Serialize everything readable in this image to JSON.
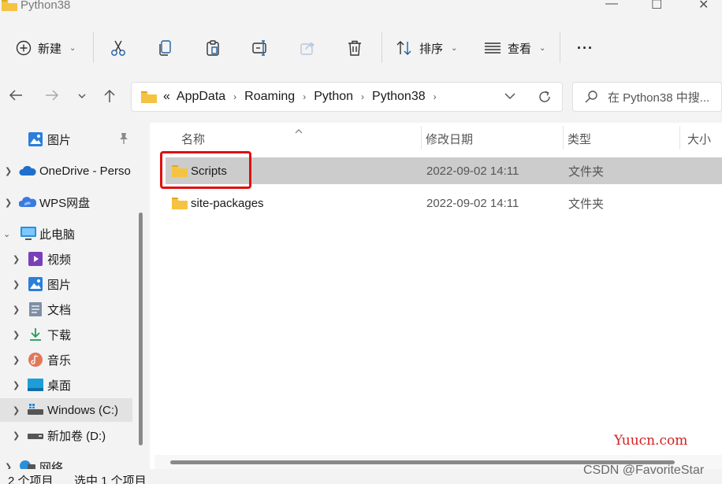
{
  "window": {
    "title": "Python38",
    "minimize": "—",
    "maximize": "☐",
    "close": "✕"
  },
  "toolbar": {
    "new_label": "新建",
    "sort_label": "排序",
    "view_label": "查看",
    "more_label": "···"
  },
  "address": {
    "overflow": "«",
    "crumbs": [
      "AppData",
      "Roaming",
      "Python",
      "Python38"
    ],
    "search_placeholder": "在 Python38 中搜..."
  },
  "sidebar": {
    "items": [
      {
        "label": "图片",
        "icon": "pictures-icon"
      },
      {
        "label": "OneDrive - Perso",
        "icon": "onedrive-icon"
      },
      {
        "label": "WPS网盘",
        "icon": "wps-cloud-icon"
      },
      {
        "label": "此电脑",
        "icon": "this-pc-icon"
      },
      {
        "label": "视频",
        "icon": "videos-icon"
      },
      {
        "label": "图片",
        "icon": "pictures-icon"
      },
      {
        "label": "文档",
        "icon": "documents-icon"
      },
      {
        "label": "下载",
        "icon": "downloads-icon"
      },
      {
        "label": "音乐",
        "icon": "music-icon"
      },
      {
        "label": "桌面",
        "icon": "desktop-icon"
      },
      {
        "label": "Windows (C:)",
        "icon": "drive-c-icon"
      },
      {
        "label": "新加卷 (D:)",
        "icon": "drive-d-icon"
      },
      {
        "label": "网络",
        "icon": "network-icon"
      }
    ]
  },
  "columns": {
    "name": "名称",
    "date": "修改日期",
    "type": "类型",
    "size": "大小"
  },
  "files": [
    {
      "name": "Scripts",
      "date": "2022-09-02 14:11",
      "type": "文件夹"
    },
    {
      "name": "site-packages",
      "date": "2022-09-02 14:11",
      "type": "文件夹"
    }
  ],
  "status": {
    "count": "2 个项目",
    "selection": "选中 1 个项目"
  },
  "watermarks": {
    "site": "Yuucn.com",
    "author": "CSDN @FavoriteStar"
  },
  "colors": {
    "folder": "#f5c342",
    "highlight": "#e01010",
    "selected_row": "#cccccc"
  }
}
